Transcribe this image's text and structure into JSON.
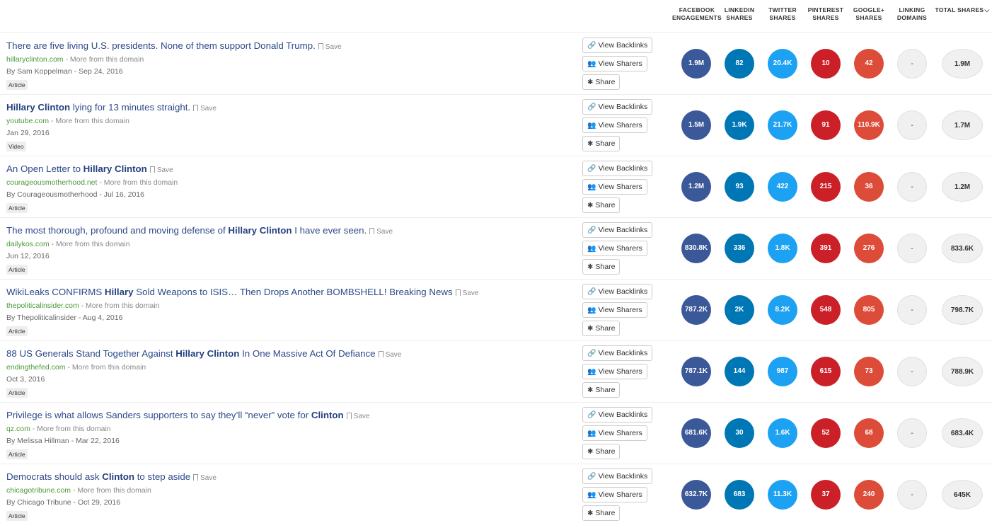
{
  "headers": {
    "facebook": [
      "FACEBOOK",
      "ENGAGEMENTS"
    ],
    "linkedin": [
      "LINKEDIN",
      "SHARES"
    ],
    "twitter": [
      "TWITTER",
      "SHARES"
    ],
    "pinterest": [
      "PINTEREST",
      "SHARES"
    ],
    "google": [
      "GOOGLE+",
      "SHARES"
    ],
    "linking": [
      "LINKING",
      "DOMAINS"
    ],
    "total": "TOTAL SHARES"
  },
  "actions": {
    "backlinks": "View Backlinks",
    "sharers": "View Sharers",
    "share": "Share",
    "save": "Save",
    "more": " - More from this domain"
  },
  "rows": [
    {
      "title_parts": [
        {
          "t": "There are five living U.S. presidents. None of them support Donald Trump.",
          "b": false
        }
      ],
      "domain": "hillaryclinton.com",
      "byline": "By Sam Koppelman - Sep 24, 2016",
      "type": "Article",
      "stats": {
        "fb": "1.9M",
        "li": "82",
        "tw": "20.4K",
        "pi": "10",
        "gp": "42",
        "ld": "-",
        "total": "1.9M"
      }
    },
    {
      "title_parts": [
        {
          "t": "Hillary Clinton",
          "b": true
        },
        {
          "t": " lying for 13 minutes straight.",
          "b": false
        }
      ],
      "domain": "youtube.com",
      "byline": "Jan 29, 2016",
      "type": "Video",
      "stats": {
        "fb": "1.5M",
        "li": "1.9K",
        "tw": "21.7K",
        "pi": "91",
        "gp": "110.9K",
        "ld": "-",
        "total": "1.7M"
      }
    },
    {
      "title_parts": [
        {
          "t": "An Open Letter to ",
          "b": false
        },
        {
          "t": "Hillary Clinton",
          "b": true
        }
      ],
      "domain": "courageousmotherhood.net",
      "byline": "By Courageousmotherhood - Jul 16, 2016",
      "type": "Article",
      "stats": {
        "fb": "1.2M",
        "li": "93",
        "tw": "422",
        "pi": "215",
        "gp": "36",
        "ld": "-",
        "total": "1.2M"
      }
    },
    {
      "title_parts": [
        {
          "t": "The most thorough, profound and moving defense of ",
          "b": false
        },
        {
          "t": "Hillary Clinton",
          "b": true
        },
        {
          "t": " I have ever seen.",
          "b": false
        }
      ],
      "domain": "dailykos.com",
      "byline": "Jun 12, 2016",
      "type": "Article",
      "stats": {
        "fb": "830.8K",
        "li": "336",
        "tw": "1.8K",
        "pi": "391",
        "gp": "276",
        "ld": "-",
        "total": "833.6K"
      }
    },
    {
      "title_parts": [
        {
          "t": "WikiLeaks CONFIRMS ",
          "b": false
        },
        {
          "t": "Hillary",
          "b": true
        },
        {
          "t": " Sold Weapons to ISIS… Then Drops Another BOMBSHELL! Breaking News",
          "b": false
        }
      ],
      "domain": "thepoliticalinsider.com",
      "byline": "By Thepoliticalinsider - Aug 4, 2016",
      "type": "Article",
      "stats": {
        "fb": "787.2K",
        "li": "2K",
        "tw": "8.2K",
        "pi": "548",
        "gp": "805",
        "ld": "-",
        "total": "798.7K"
      }
    },
    {
      "title_parts": [
        {
          "t": "88 US Generals Stand Together Against ",
          "b": false
        },
        {
          "t": "Hillary Clinton",
          "b": true
        },
        {
          "t": " In One Massive Act Of Defiance",
          "b": false
        }
      ],
      "domain": "endingthefed.com",
      "byline": "Oct 3, 2016",
      "type": "Article",
      "stats": {
        "fb": "787.1K",
        "li": "144",
        "tw": "987",
        "pi": "615",
        "gp": "73",
        "ld": "-",
        "total": "788.9K"
      }
    },
    {
      "title_parts": [
        {
          "t": "Privilege is what allows Sanders supporters to say they’ll “never” vote for ",
          "b": false
        },
        {
          "t": "Clinton",
          "b": true
        }
      ],
      "domain": "qz.com",
      "byline": "By Melissa Hillman - Mar 22, 2016",
      "type": "Article",
      "stats": {
        "fb": "681.6K",
        "li": "30",
        "tw": "1.6K",
        "pi": "52",
        "gp": "68",
        "ld": "-",
        "total": "683.4K"
      }
    },
    {
      "title_parts": [
        {
          "t": "Democrats should ask ",
          "b": false
        },
        {
          "t": "Clinton",
          "b": true
        },
        {
          "t": " to step aside",
          "b": false
        }
      ],
      "domain": "chicagotribune.com",
      "byline": "By Chicago Tribune - Oct 29, 2016",
      "type": "Article",
      "stats": {
        "fb": "632.7K",
        "li": "683",
        "tw": "11.3K",
        "pi": "37",
        "gp": "240",
        "ld": "-",
        "total": "645K"
      }
    }
  ]
}
